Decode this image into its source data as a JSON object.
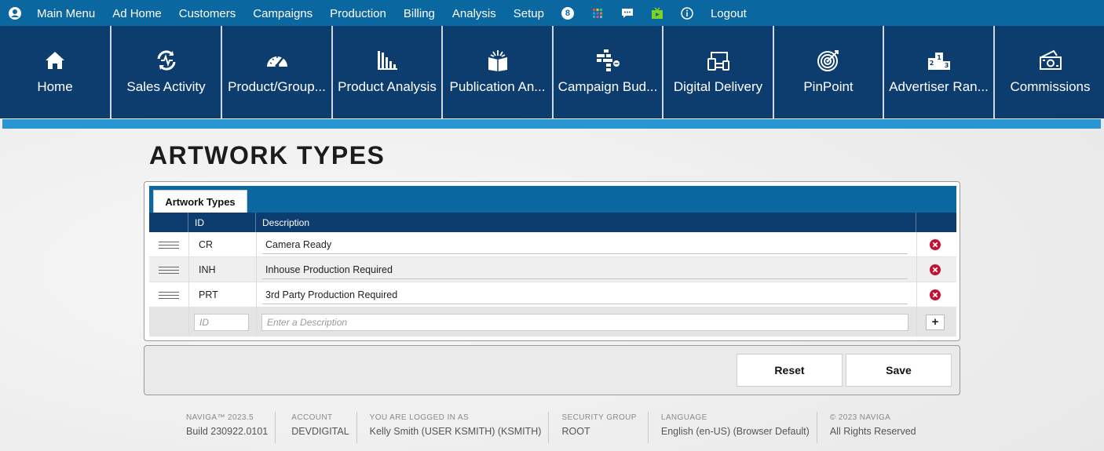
{
  "topbar": {
    "menu": [
      "Main Menu",
      "Ad Home",
      "Customers",
      "Campaigns",
      "Production",
      "Billing",
      "Analysis",
      "Setup"
    ],
    "badge_count": "8",
    "logout": "Logout"
  },
  "tiles": [
    {
      "label": "Home",
      "icon": "home-icon"
    },
    {
      "label": "Sales Activity",
      "icon": "sales-activity-icon"
    },
    {
      "label": "Product/Group...",
      "icon": "gauge-icon"
    },
    {
      "label": "Product Analysis",
      "icon": "bar-chart-icon"
    },
    {
      "label": "Publication An...",
      "icon": "open-book-icon"
    },
    {
      "label": "Campaign Bud...",
      "icon": "budget-blocks-icon"
    },
    {
      "label": "Digital Delivery",
      "icon": "devices-icon"
    },
    {
      "label": "PinPoint",
      "icon": "target-icon"
    },
    {
      "label": "Advertiser Ran...",
      "icon": "podium-icon"
    },
    {
      "label": "Commissions",
      "icon": "money-icon"
    }
  ],
  "page": {
    "title": "ARTWORK TYPES"
  },
  "grid": {
    "tab": "Artwork Types",
    "columns": {
      "id": "ID",
      "description": "Description"
    },
    "rows": [
      {
        "id": "CR",
        "description": "Camera Ready"
      },
      {
        "id": "INH",
        "description": "Inhouse Production Required"
      },
      {
        "id": "PRT",
        "description": "3rd Party Production Required"
      }
    ],
    "new_row": {
      "id_placeholder": "ID",
      "description_placeholder": "Enter a Description",
      "add_label": "+"
    }
  },
  "buttons": {
    "reset": "Reset",
    "save": "Save"
  },
  "footer": [
    {
      "caption": "NAVIGA™ 2023.5",
      "value": "Build 230922.0101"
    },
    {
      "caption": "ACCOUNT",
      "value": "DEVDIGITAL"
    },
    {
      "caption": "YOU ARE LOGGED IN AS",
      "value": "Kelly Smith (USER KSMITH) (KSMITH)"
    },
    {
      "caption": "SECURITY GROUP",
      "value": "ROOT"
    },
    {
      "caption": "LANGUAGE",
      "value": "English (en-US) (Browser Default)"
    },
    {
      "caption": "© 2023 NAVIGA",
      "value": "All Rights Reserved"
    }
  ],
  "colors": {
    "topbar": "#0b67a0",
    "tile": "#0d3d6e",
    "accent": "#2a95d3",
    "delete": "#c8102e"
  }
}
